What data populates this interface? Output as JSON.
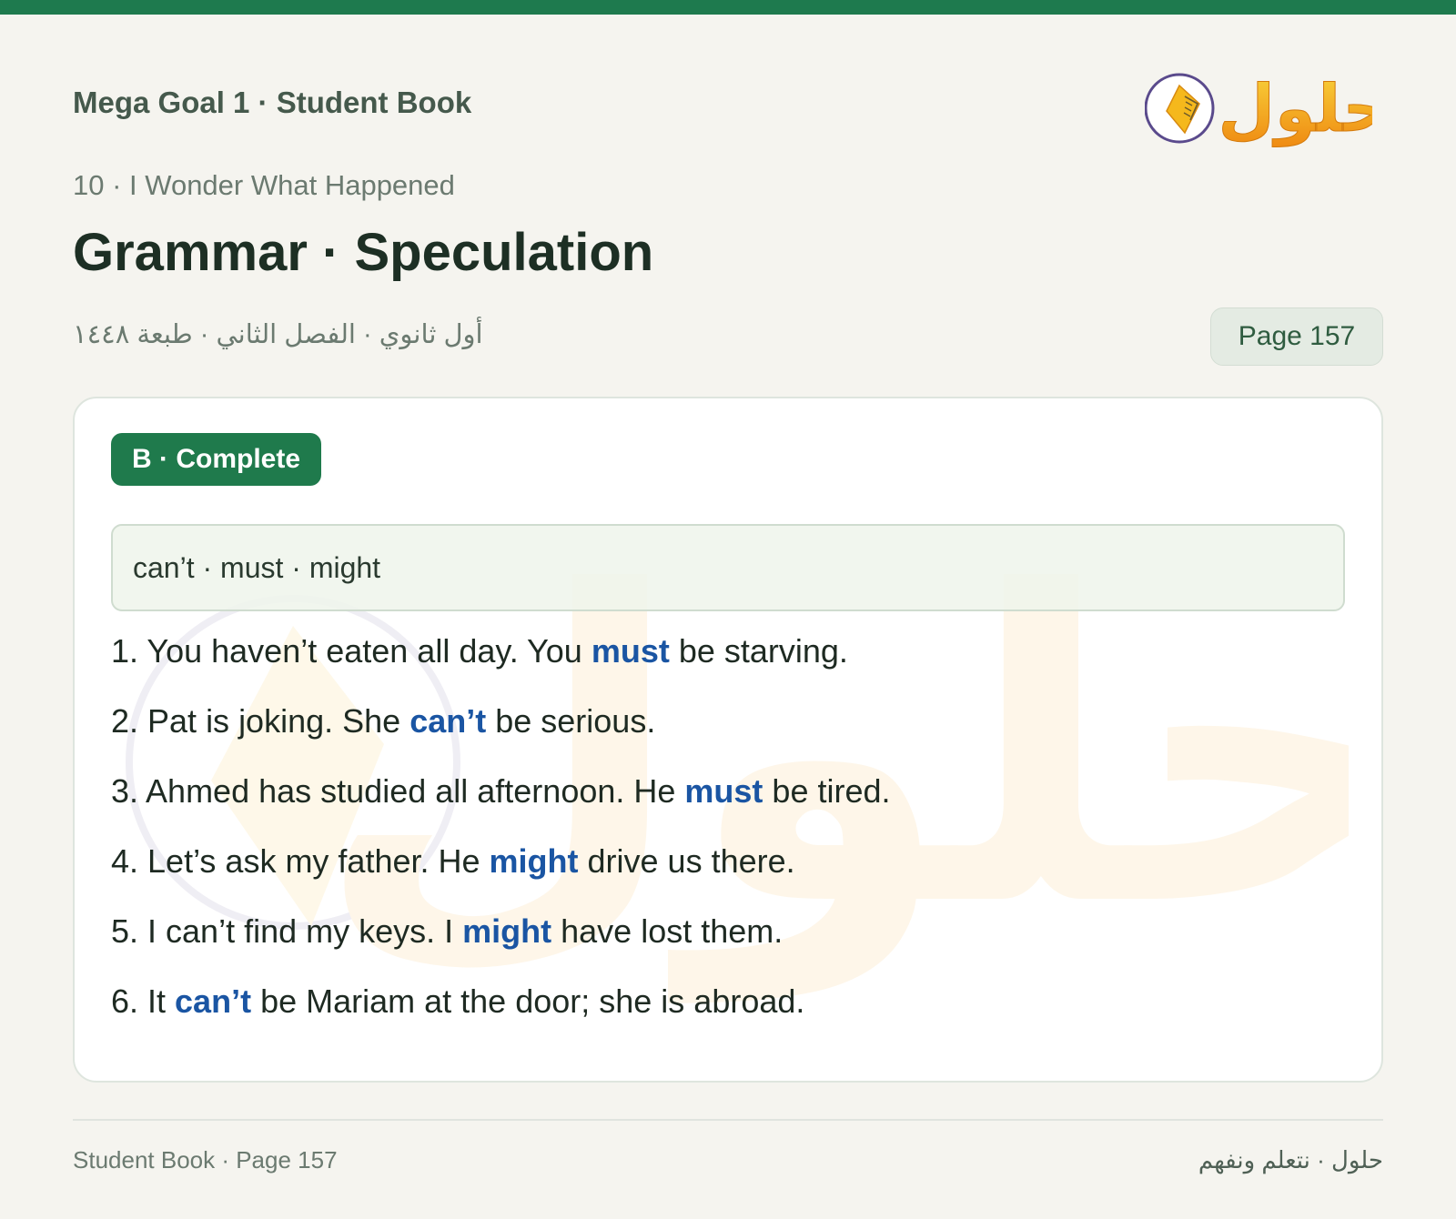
{
  "header": {
    "book_title": "Mega Goal 1 · Student Book",
    "logo_text": "حلول",
    "unit": "10 · I Wonder What Happened",
    "title": "Grammar · Speculation",
    "meta_ar": "أول ثانوي · الفصل الثاني · طبعة ١٤٤٨",
    "page_badge": "Page 157"
  },
  "exercise": {
    "label": "B · Complete",
    "word_bank": "can’t · must · might",
    "items": [
      {
        "before": "1. You haven’t eaten all day. You ",
        "answer": "must",
        "after": " be starving."
      },
      {
        "before": "2. Pat is joking. She ",
        "answer": "can’t",
        "after": " be serious."
      },
      {
        "before": "3. Ahmed has studied all afternoon. He ",
        "answer": "must",
        "after": " be tired."
      },
      {
        "before": "4. Let’s ask my father. He ",
        "answer": "might",
        "after": " drive us there."
      },
      {
        "before": "5. I can’t find my keys. I ",
        "answer": "might",
        "after": " have lost them."
      },
      {
        "before": "6. It ",
        "answer": "can’t",
        "after": " be Mariam at the door; she is abroad."
      }
    ]
  },
  "footer": {
    "left": "Student Book · Page 157",
    "right": "حلول · نتعلم ونفهم"
  },
  "colors": {
    "brand_green": "#1e7a4e",
    "answer_blue": "#1a55a3",
    "logo_yellow": "#f5b81c",
    "logo_orange": "#ef8a12"
  }
}
